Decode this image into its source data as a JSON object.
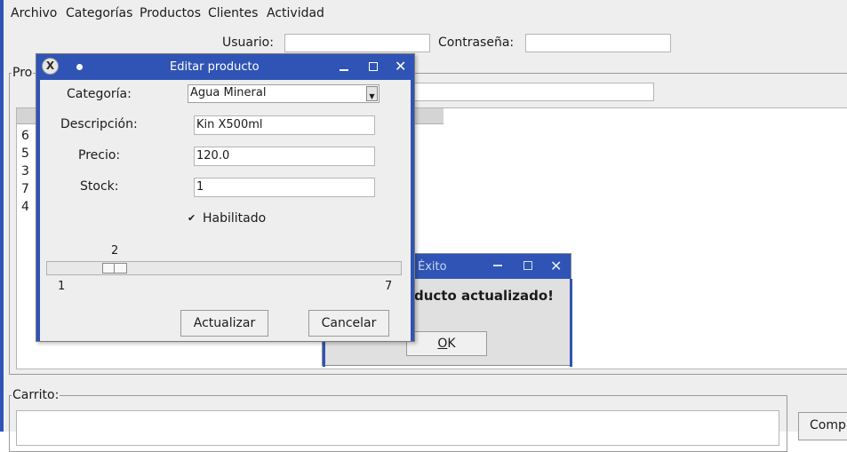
{
  "menu": [
    "Archivo",
    "Categorías",
    "Productos",
    "Clientes",
    "Actividad"
  ],
  "login": {
    "user_label": "Usuario:",
    "user_value": "",
    "password_label": "Contraseña:",
    "password_value": ""
  },
  "products_panel": {
    "legend": "Pro",
    "list_rows": [
      "6",
      "5",
      "3",
      "7",
      "4"
    ]
  },
  "cart_panel": {
    "legend": "Carrito:",
    "side_button": "Comp"
  },
  "edit_dialog": {
    "title": "Editar producto",
    "category_label": "Categoría:",
    "category_value": "Agua Mineral",
    "description_label": "Descripción:",
    "description_value": "Kin X500ml",
    "price_label": "Precio:",
    "price_value": "120.0",
    "stock_label": "Stock:",
    "stock_value": "1",
    "enabled_label": "Habilitado",
    "enabled_checked": true,
    "slider": {
      "value": "2",
      "min": "1",
      "max": "7"
    },
    "update_button": "Actualizar",
    "cancel_button": "Cancelar"
  },
  "success_dialog": {
    "title": "Éxito",
    "message": "ducto actualizado!",
    "ok_button_rest": "K",
    "ok_button_mnemonic": "O"
  }
}
